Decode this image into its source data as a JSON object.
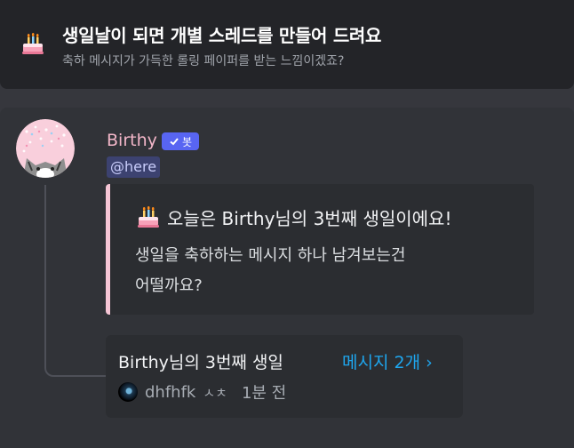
{
  "header": {
    "title": "생일날이 되면 개별 스레드를 만들어 드려요",
    "subtitle": "축하 메시지가 가득한 롤링 페이퍼를 받는 느낌이겠죠?",
    "icon": "birthday-cake-icon"
  },
  "message": {
    "author": "Birthy",
    "author_color": "#f2b6c8",
    "badge_label": "봇",
    "mention": "@here",
    "embed": {
      "accent_color": "#f5c5d5",
      "title": "오늘은 Birthy님의 3번째 생일이에요!",
      "description_line1": "생일을 축하하는 메시지 하나 남겨보는건",
      "description_line2": "어떨까요?"
    },
    "thread": {
      "name": "Birthy님의 3번째 생일",
      "count_label": "메시지 2개 ›",
      "last_user": "dhfhfk",
      "last_preview": "ㅅㅊ",
      "time": "1분 전"
    }
  },
  "colors": {
    "background": "#313338",
    "header_bg": "#232428",
    "link": "#1ea7f0",
    "badge": "#5865f2"
  }
}
